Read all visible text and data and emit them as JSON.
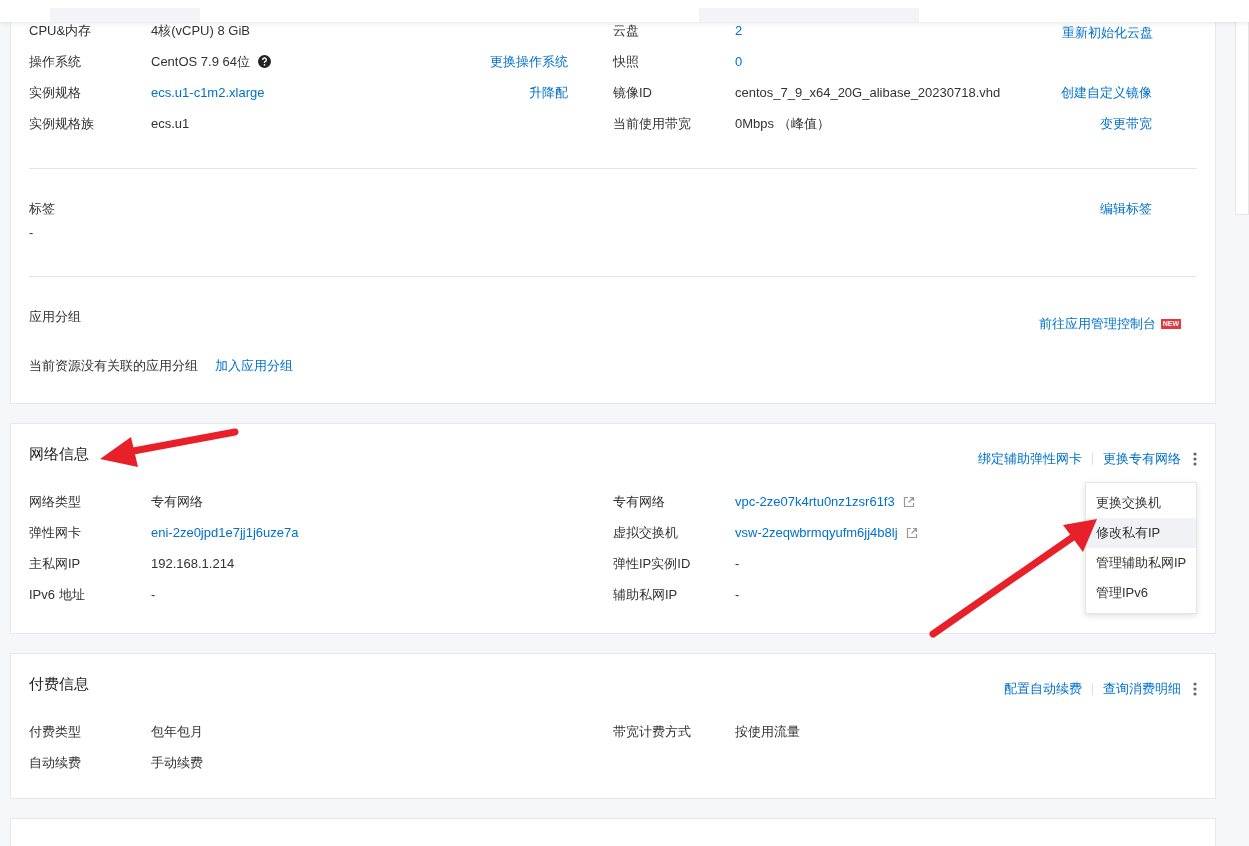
{
  "instance": {
    "corner_action": "重新初始化云盘",
    "rows": [
      {
        "left": {
          "label": "CPU&内存",
          "value": "4核(vCPU) 8 GiB",
          "kind": "text",
          "help": false
        },
        "right": {
          "label": "云盘",
          "value": "2",
          "kind": "link"
        }
      },
      {
        "left": {
          "label": "操作系统",
          "value": "CentOS 7.9 64位",
          "kind": "text",
          "help": true,
          "action": "更换操作系统"
        },
        "right": {
          "label": "快照",
          "value": "0",
          "kind": "link"
        }
      },
      {
        "left": {
          "label": "实例规格",
          "value": "ecs.u1-c1m2.xlarge",
          "kind": "link",
          "help": false,
          "action": "升降配"
        },
        "right": {
          "label": "镜像ID",
          "value": "centos_7_9_x64_20G_alibase_20230718.vhd",
          "kind": "text",
          "action": "创建自定义镜像"
        }
      },
      {
        "left": {
          "label": "实例规格族",
          "value": "ecs.u1",
          "kind": "text",
          "help": false
        },
        "right": {
          "label": "当前使用带宽",
          "value": "0Mbps （峰值）",
          "kind": "text",
          "action": "变更带宽"
        }
      }
    ],
    "tags": {
      "title": "标签",
      "value": "-",
      "action": "编辑标签"
    },
    "app_group": {
      "title": "应用分组",
      "action": "前往应用管理控制台",
      "badge": "NEW",
      "note": "当前资源没有关联的应用分组",
      "link": "加入应用分组"
    }
  },
  "network": {
    "title": "网络信息",
    "actions": [
      "绑定辅助弹性网卡",
      "更换专有网络"
    ],
    "menu": [
      {
        "label": "更换交换机",
        "selected": false
      },
      {
        "label": "修改私有IP",
        "selected": true
      },
      {
        "label": "管理辅助私网IP",
        "selected": false
      },
      {
        "label": "管理IPv6",
        "selected": false
      }
    ],
    "rows": [
      {
        "left": {
          "label": "网络类型",
          "value": "专有网络",
          "kind": "text"
        },
        "right": {
          "label": "专有网络",
          "value": "vpc-2ze07k4rtu0nz1zsr61f3",
          "kind": "link",
          "external": true
        }
      },
      {
        "left": {
          "label": "弹性网卡",
          "value": "eni-2ze0jpd1e7jj1j6uze7a",
          "kind": "link"
        },
        "right": {
          "label": "虚拟交换机",
          "value": "vsw-2zeqwbrmqyufm6jj4b8lj",
          "kind": "link",
          "external": true
        }
      },
      {
        "left": {
          "label": "主私网IP",
          "value": "192.168.1.214",
          "kind": "text"
        },
        "right": {
          "label": "弹性IP实例ID",
          "value": "-",
          "kind": "text"
        }
      },
      {
        "left": {
          "label": "IPv6 地址",
          "value": "-",
          "kind": "text"
        },
        "right": {
          "label": "辅助私网IP",
          "value": "-",
          "kind": "text"
        }
      }
    ]
  },
  "billing": {
    "title": "付费信息",
    "actions": [
      "配置自动续费",
      "查询消费明细"
    ],
    "rows": [
      {
        "left": {
          "label": "付费类型",
          "value": "包年包月",
          "kind": "text"
        },
        "right": {
          "label": "带宽计费方式",
          "value": "按使用流量",
          "kind": "text"
        }
      },
      {
        "left": {
          "label": "自动续费",
          "value": "手动续费",
          "kind": "text"
        }
      }
    ]
  }
}
